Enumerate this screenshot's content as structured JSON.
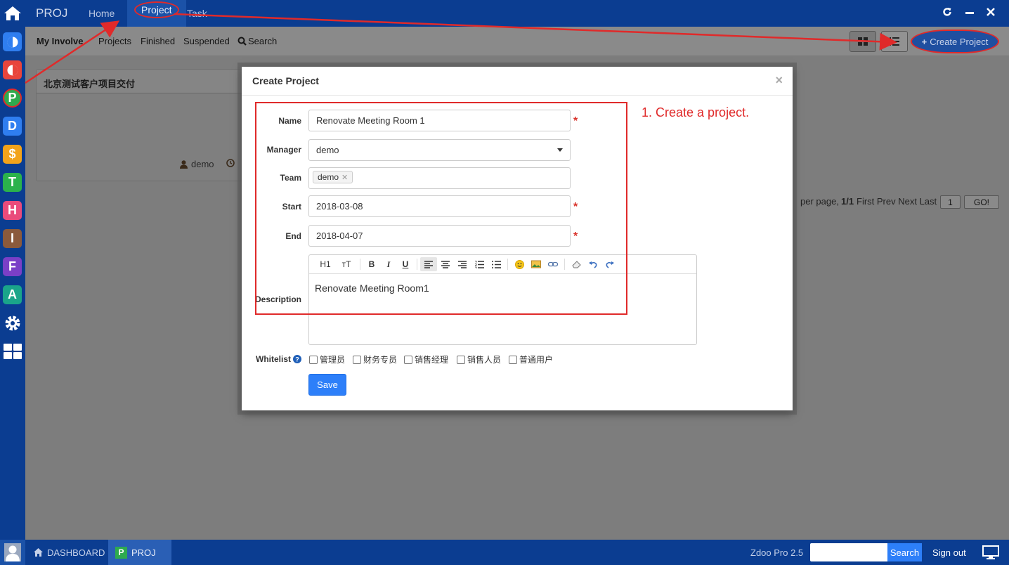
{
  "topbar": {
    "brand": "PROJ",
    "nav": [
      "Home",
      "Project",
      "Task"
    ]
  },
  "subnav": {
    "items": [
      "My Involve",
      "Projects",
      "Finished",
      "Suspended",
      "Search"
    ],
    "create_label": "Create Project"
  },
  "card": {
    "title": "北京测试客户项目交付",
    "user": "demo"
  },
  "pager": {
    "per_page": "per page,",
    "page_count": "1/1",
    "links": "First Prev Next Last",
    "page_input": "1",
    "go_label": "GO!"
  },
  "modal": {
    "title": "Create Project",
    "close": "×",
    "labels": {
      "name": "Name",
      "manager": "Manager",
      "team": "Team",
      "start": "Start",
      "end": "End",
      "description": "Description",
      "whitelist": "Whitelist"
    },
    "required_mark": "*",
    "name_value": "Renovate Meeting Room 1",
    "manager_value": "demo",
    "team_tag": "demo",
    "start_value": "2018-03-08",
    "end_value": "2018-04-07",
    "description_value": "Renovate Meeting Room1",
    "toolbar": [
      "H1",
      "тT",
      "B",
      "I",
      "U"
    ],
    "whitelist_options": [
      "管理员",
      "财务专员",
      "销售经理",
      "销售人员",
      "普通用户"
    ],
    "save_label": "Save"
  },
  "annotation": {
    "text": "1. Create a project.",
    "color": "#e02a2a"
  },
  "bottombar": {
    "dashboard": "DASHBOARD",
    "app": "PROJ",
    "version": "Zdoo Pro 2.5",
    "search_label": "Search",
    "signout": "Sign out"
  },
  "colors": {
    "navy": "#0b3d91",
    "primary": "#2d7ff9",
    "required": "#d9332b"
  }
}
